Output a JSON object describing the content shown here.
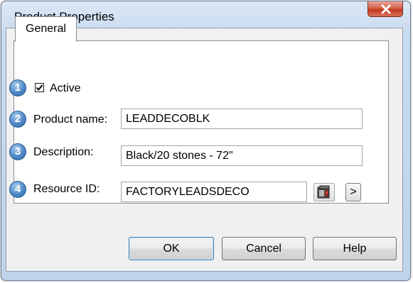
{
  "window": {
    "title": "Product Properties"
  },
  "tabs": [
    {
      "label": "General",
      "selected": true
    }
  ],
  "form": {
    "badges": [
      "1",
      "2",
      "3",
      "4"
    ],
    "active": {
      "label": "Active",
      "checked": true
    },
    "product_name": {
      "label": "Product name:",
      "value": "LEADDECOBLK"
    },
    "description": {
      "label": "Description:",
      "value": "Black/20 stones - 72\""
    },
    "resource_id": {
      "label": "Resource ID:",
      "value": "FACTORYLEADSDECO",
      "more_label": ">"
    }
  },
  "buttons": {
    "ok": "OK",
    "cancel": "Cancel",
    "help": "Help"
  },
  "icons": {
    "close": "close-icon",
    "resource_browser": "cabinet-icon",
    "checkmark": "checkmark-icon"
  },
  "colors": {
    "badge": "#4f89c7",
    "close": "#c1391f",
    "title_bar": "#c9dbef"
  }
}
